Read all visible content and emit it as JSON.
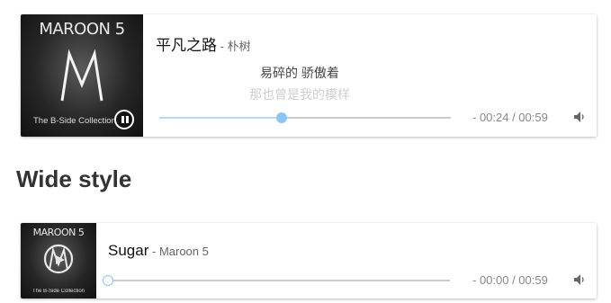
{
  "players": [
    {
      "cover": {
        "brand": "MAROON 5",
        "subtitle": "The B-Side Collection"
      },
      "title": "平凡之路",
      "separator": " - ",
      "author": "朴树",
      "lyrics": {
        "current": "易碎的 骄傲着",
        "next": "那也曾是我的模样"
      },
      "progress": 0.42,
      "time": "- 00:24 / 00:59",
      "state": "playing",
      "volume_icon": "speaker-icon",
      "accent": "#8cc4f4"
    },
    {
      "cover": {
        "brand": "MAROON 5",
        "subtitle": "The B-Side Collection"
      },
      "title": "Sugar",
      "separator": " - ",
      "author": "Maroon 5",
      "progress": 0.0,
      "time": "- 00:00 / 00:59",
      "state": "paused",
      "volume_icon": "speaker-icon",
      "accent": "#8cc4f4"
    }
  ],
  "section_heading": "Wide style"
}
